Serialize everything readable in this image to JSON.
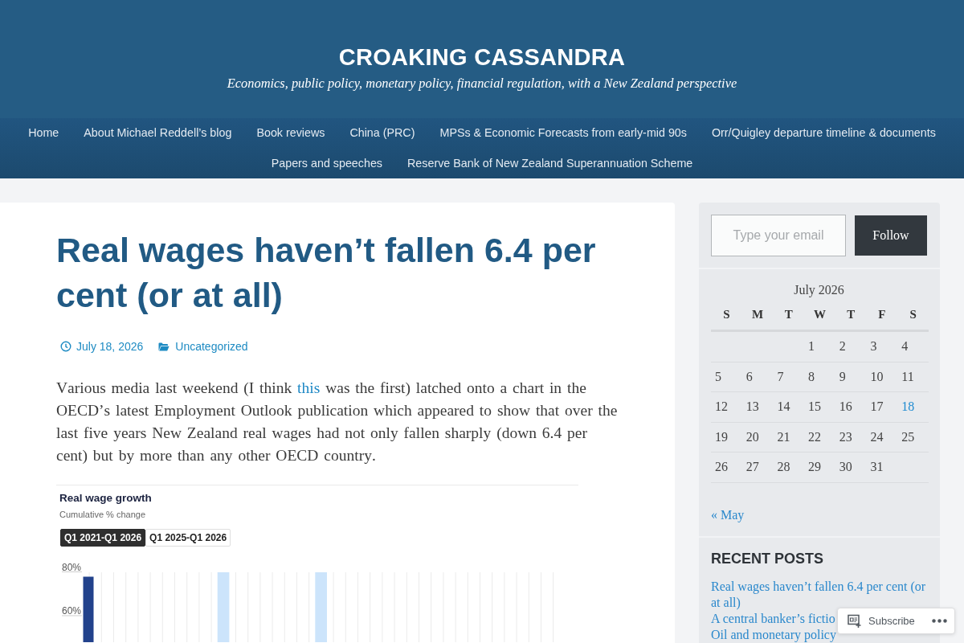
{
  "header": {
    "title": "CROAKING CASSANDRA",
    "tagline": "Economics, public policy, monetary policy, financial regulation, with a New Zealand perspective"
  },
  "nav": [
    "Home",
    "About Michael Reddell’s blog",
    "Book reviews",
    "China (PRC)",
    "MPSs & Economic Forecasts from early-mid 90s",
    "Orr/Quigley departure timeline & documents",
    "Papers and speeches",
    "Reserve Bank of New Zealand Superannuation Scheme"
  ],
  "post": {
    "title": "Real wages haven’t fallen 6.4 per cent (or at all)",
    "date": "July 18, 2026",
    "category": "Uncategorized",
    "paragraph": [
      {
        "kind": "text",
        "text": "Various media last weekend (I think "
      },
      {
        "kind": "link",
        "text": "this"
      },
      {
        "kind": "text",
        "text": " was the first) latched onto a chart in the OECD’s latest Employment Outlook publication which appeared to show that over the last five years New Zealand real wages had not only fallen sharply (down 6.4 per cent) but by more than any other OECD country."
      }
    ],
    "figure": {
      "title": "Real wage growth",
      "subtitle": "Cumulative % change",
      "periods": [
        {
          "label": "Q1 2021-Q1 2026",
          "selected": true
        },
        {
          "label": "Q1 2025-Q1 2026",
          "selected": false
        }
      ],
      "axis_labels": [
        "80%",
        "60%"
      ]
    }
  },
  "sidebar": {
    "follow": {
      "placeholder": "Type your email",
      "button": "Follow"
    },
    "calendar": {
      "caption": "July 2026",
      "weekdays": [
        "S",
        "M",
        "T",
        "W",
        "T",
        "F",
        "S"
      ],
      "weeks": [
        {
          "kind": "opening",
          "days": [
            {
              "day": "1",
              "link": false
            },
            {
              "day": "2",
              "link": false
            },
            {
              "day": "3",
              "link": false
            },
            {
              "day": "4",
              "link": false
            }
          ]
        },
        {
          "kind": "full",
          "days": [
            {
              "day": "5",
              "link": false
            },
            {
              "day": "6",
              "link": false
            },
            {
              "day": "7",
              "link": false
            },
            {
              "day": "8",
              "link": false
            },
            {
              "day": "9",
              "link": false
            },
            {
              "day": "10",
              "link": false
            },
            {
              "day": "11",
              "link": false
            }
          ]
        },
        {
          "kind": "full",
          "days": [
            {
              "day": "12",
              "link": false
            },
            {
              "day": "13",
              "link": false
            },
            {
              "day": "14",
              "link": false
            },
            {
              "day": "15",
              "link": false
            },
            {
              "day": "16",
              "link": false
            },
            {
              "day": "17",
              "link": false
            },
            {
              "day": "18",
              "link": true
            }
          ]
        },
        {
          "kind": "full",
          "days": [
            {
              "day": "19",
              "link": false
            },
            {
              "day": "20",
              "link": false
            },
            {
              "day": "21",
              "link": false
            },
            {
              "day": "22",
              "link": false
            },
            {
              "day": "23",
              "link": false
            },
            {
              "day": "24",
              "link": false
            },
            {
              "day": "25",
              "link": false
            }
          ]
        },
        {
          "kind": "closing",
          "days": [
            {
              "day": "26",
              "link": false
            },
            {
              "day": "27",
              "link": false
            },
            {
              "day": "28",
              "link": false
            },
            {
              "day": "29",
              "link": false
            },
            {
              "day": "30",
              "link": false
            },
            {
              "day": "31",
              "link": false
            }
          ]
        }
      ],
      "prev_link": "« May"
    },
    "recent_posts": {
      "title": "RECENT POSTS",
      "items": [
        "Real wages haven’t fallen 6.4 per cent (or at all)",
        "A central banker’s fictio",
        "Oil and monetary policy"
      ]
    }
  },
  "subscribe_bar": {
    "label": "Subscribe"
  }
}
